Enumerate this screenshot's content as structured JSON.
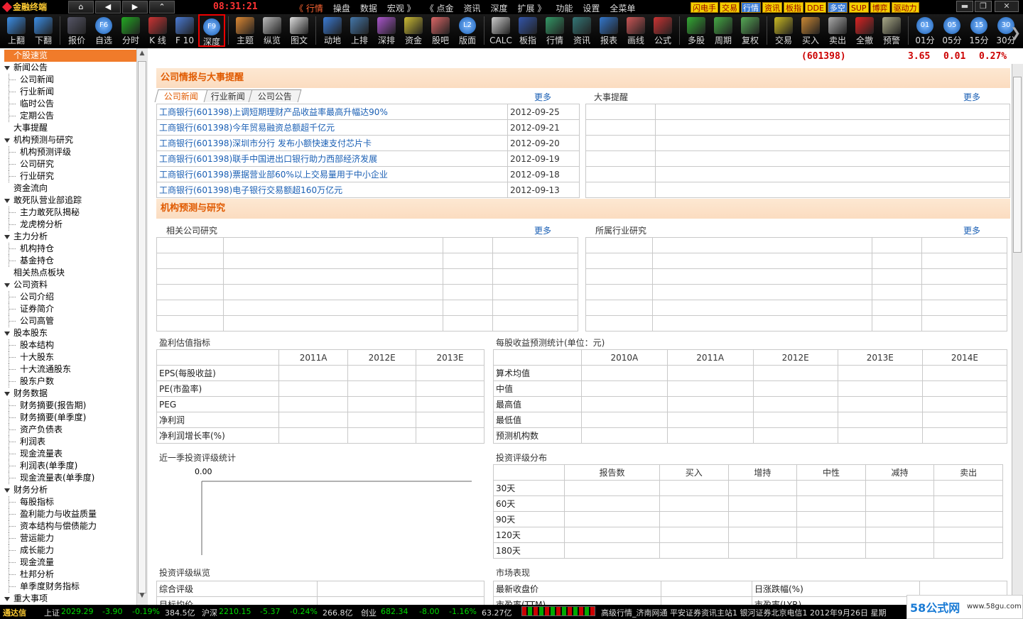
{
  "app": {
    "title": "金融终端",
    "clock": "08:31:21"
  },
  "top_menu": [
    "《 行情",
    "操盘",
    "数据",
    "宏观 》",
    "《 点金",
    "资讯",
    "深度",
    "扩展 》",
    "功能",
    "设置",
    "全菜单"
  ],
  "top_tags": [
    "闪电手",
    "交易",
    "行情",
    "资讯",
    "板指",
    "DDE",
    "多空",
    "SUP",
    "博弈",
    "驱动力"
  ],
  "toolbar": [
    {
      "label": "上翻",
      "icon": "arrow-up-icon"
    },
    {
      "label": "下翻",
      "icon": "arrow-down-icon"
    },
    {
      "label": "报价",
      "icon": "quote-icon"
    },
    {
      "label": "自选",
      "icon": "f6-icon",
      "key": "F6"
    },
    {
      "label": "分时",
      "icon": "timeline-icon"
    },
    {
      "label": "K 线",
      "icon": "kline-icon"
    },
    {
      "label": "F 10",
      "icon": "f10-icon"
    },
    {
      "label": "深度",
      "icon": "f9-icon",
      "key": "F9"
    },
    {
      "label": "主题",
      "icon": "home-icon"
    },
    {
      "label": "纵览",
      "icon": "overview-icon"
    },
    {
      "label": "图文",
      "icon": "doc-icon"
    },
    {
      "label": "动地",
      "icon": "motion-icon"
    },
    {
      "label": "上排",
      "icon": "rank-icon"
    },
    {
      "label": "深排",
      "icon": "rank2-icon"
    },
    {
      "label": "资金",
      "icon": "fund-icon"
    },
    {
      "label": "股吧",
      "icon": "forum-icon"
    },
    {
      "label": "版面",
      "icon": "l2-icon",
      "key": "L2"
    },
    {
      "label": "CALC",
      "icon": "calc-icon"
    },
    {
      "label": "板指",
      "icon": "board-icon"
    },
    {
      "label": "行情",
      "icon": "market-icon"
    },
    {
      "label": "资讯",
      "icon": "news-icon"
    },
    {
      "label": "报表",
      "icon": "report-icon"
    },
    {
      "label": "画线",
      "icon": "draw-icon"
    },
    {
      "label": "公式",
      "icon": "formula-icon"
    },
    {
      "label": "多股",
      "icon": "multi-icon"
    },
    {
      "label": "周期",
      "icon": "period-icon"
    },
    {
      "label": "复权",
      "icon": "restore-icon"
    },
    {
      "label": "交易",
      "icon": "trade-icon"
    },
    {
      "label": "买入",
      "icon": "buy-icon"
    },
    {
      "label": "卖出",
      "icon": "sell-icon"
    },
    {
      "label": "全撤",
      "icon": "cancel-all-icon"
    },
    {
      "label": "预警",
      "icon": "alert-icon"
    },
    {
      "label": "01分",
      "icon": "min01-icon",
      "key": "01"
    },
    {
      "label": "05分",
      "icon": "min05-icon",
      "key": "05"
    },
    {
      "label": "15分",
      "icon": "min15-icon",
      "key": "15"
    },
    {
      "label": "30分",
      "icon": "min30-icon",
      "key": "30"
    }
  ],
  "quote": {
    "code": "(601398)",
    "price": "3.65",
    "change": "0.01",
    "pct": "0.27%"
  },
  "sidebar": [
    {
      "label": "个股速览",
      "level": 0,
      "selected": true
    },
    {
      "label": "新闻公告",
      "level": 0,
      "toggle": true
    },
    {
      "label": "公司新闻",
      "level": 1
    },
    {
      "label": "行业新闻",
      "level": 1
    },
    {
      "label": "临时公告",
      "level": 1
    },
    {
      "label": "定期公告",
      "level": 1
    },
    {
      "label": "大事提醒",
      "level": 0
    },
    {
      "label": "机构预测与研究",
      "level": 0,
      "toggle": true
    },
    {
      "label": "机构预测评级",
      "level": 1
    },
    {
      "label": "公司研究",
      "level": 1
    },
    {
      "label": "行业研究",
      "level": 1
    },
    {
      "label": "资金流向",
      "level": 0
    },
    {
      "label": "敢死队营业部追踪",
      "level": 0,
      "toggle": true
    },
    {
      "label": "主力敢死队揭秘",
      "level": 1
    },
    {
      "label": "龙虎榜分析",
      "level": 1
    },
    {
      "label": "主力分析",
      "level": 0,
      "toggle": true
    },
    {
      "label": "机构持仓",
      "level": 1
    },
    {
      "label": "基金持仓",
      "level": 1
    },
    {
      "label": "相关热点板块",
      "level": 0
    },
    {
      "label": "公司资料",
      "level": 0,
      "toggle": true
    },
    {
      "label": "公司介绍",
      "level": 1
    },
    {
      "label": "证券简介",
      "level": 1
    },
    {
      "label": "公司高管",
      "level": 1
    },
    {
      "label": "股本股东",
      "level": 0,
      "toggle": true
    },
    {
      "label": "股本结构",
      "level": 1
    },
    {
      "label": "十大股东",
      "level": 1
    },
    {
      "label": "十大流通股东",
      "level": 1
    },
    {
      "label": "股东户数",
      "level": 1
    },
    {
      "label": "财务数据",
      "level": 0,
      "toggle": true
    },
    {
      "label": "财务摘要(报告期)",
      "level": 1
    },
    {
      "label": "财务摘要(单季度)",
      "level": 1
    },
    {
      "label": "资产负债表",
      "level": 1
    },
    {
      "label": "利润表",
      "level": 1
    },
    {
      "label": "现金流量表",
      "level": 1
    },
    {
      "label": "利润表(单季度)",
      "level": 1
    },
    {
      "label": "现金流量表(单季度)",
      "level": 1
    },
    {
      "label": "财务分析",
      "level": 0,
      "toggle": true
    },
    {
      "label": "每股指标",
      "level": 1
    },
    {
      "label": "盈利能力与收益质量",
      "level": 1
    },
    {
      "label": "资本结构与偿债能力",
      "level": 1
    },
    {
      "label": "营运能力",
      "level": 1
    },
    {
      "label": "成长能力",
      "level": 1
    },
    {
      "label": "现金流量",
      "level": 1
    },
    {
      "label": "杜邦分析",
      "level": 1
    },
    {
      "label": "单季度财务指标",
      "level": 1
    },
    {
      "label": "重大事项",
      "level": 0,
      "toggle": true
    }
  ],
  "section1": {
    "title": "公司情报与大事提醒",
    "tabs": [
      "公司新闻",
      "行业新闻",
      "公司公告"
    ],
    "more": "更多",
    "events_label": "大事提醒",
    "news": [
      {
        "title": "工商银行(601398)上调短期理财产品收益率最高升幅达90%",
        "date": "2012-09-25"
      },
      {
        "title": "工商银行(601398)今年贸易融资总额超千亿元",
        "date": "2012-09-21"
      },
      {
        "title": "工商银行(601398)深圳市分行 发布小额快速支付芯片卡",
        "date": "2012-09-20"
      },
      {
        "title": "工商银行(601398)联手中国进出口银行助力西部经济发展",
        "date": "2012-09-19"
      },
      {
        "title": "工商银行(601398)票据营业部60%以上交易量用于中小企业",
        "date": "2012-09-18"
      },
      {
        "title": "工商银行(601398)电子银行交易额超160万亿元",
        "date": "2012-09-13"
      }
    ]
  },
  "section2": {
    "title": "机构预测与研究",
    "company_label": "相关公司研究",
    "industry_label": "所属行业研究",
    "more": "更多"
  },
  "profit": {
    "title": "盈利估值指标",
    "cols": [
      "",
      "2011A",
      "2012E",
      "2013E"
    ],
    "rows": [
      "EPS(每股收益)",
      "PE(市盈率)",
      "PEG",
      "净利润",
      "净利润增长率(%)"
    ]
  },
  "eps": {
    "title": "每股收益预测统计(单位：元)",
    "cols": [
      "",
      "2010A",
      "2011A",
      "2012E",
      "2013E",
      "2014E"
    ],
    "rows": [
      "算术均值",
      "中值",
      "最高值",
      "最低值",
      "预测机构数"
    ]
  },
  "rating_stats": {
    "title": "近一季投资评级统计",
    "value": "0.00"
  },
  "rating_dist": {
    "title": "投资评级分布",
    "cols": [
      "",
      "报告数",
      "买入",
      "增持",
      "中性",
      "减持",
      "卖出"
    ],
    "rows": [
      "30天",
      "60天",
      "90天",
      "120天",
      "180天"
    ]
  },
  "rating_overview": {
    "title": "投资评级纵览",
    "rows": [
      "综合评级",
      "目标均价"
    ]
  },
  "market": {
    "title": "市场表现",
    "rows": [
      [
        "最新收盘价",
        "日涨跌幅(%)"
      ],
      [
        "市盈率(TTM)",
        "市盈率(LYR)"
      ]
    ]
  },
  "status": {
    "brand": "通达信",
    "sh": {
      "name": "上证",
      "value": "2029.29",
      "chg": "-3.90",
      "pct": "-0.19%",
      "amt": "384.5亿"
    },
    "hs": {
      "name": "沪深",
      "value": "2210.15",
      "chg": "-5.37",
      "pct": "-0.24%",
      "amt": "266.8亿"
    },
    "cy": {
      "name": "创业",
      "value": "682.34",
      "chg": "-8.00",
      "pct": "-1.16%",
      "amt": "63.27亿"
    },
    "info": "高级行情_济南网通  平安证券资讯主站1  银河证券北京电信1  2012年9月26日 星期"
  },
  "watermark": {
    "text": "58公式网",
    "url": "www.58gu.com"
  }
}
